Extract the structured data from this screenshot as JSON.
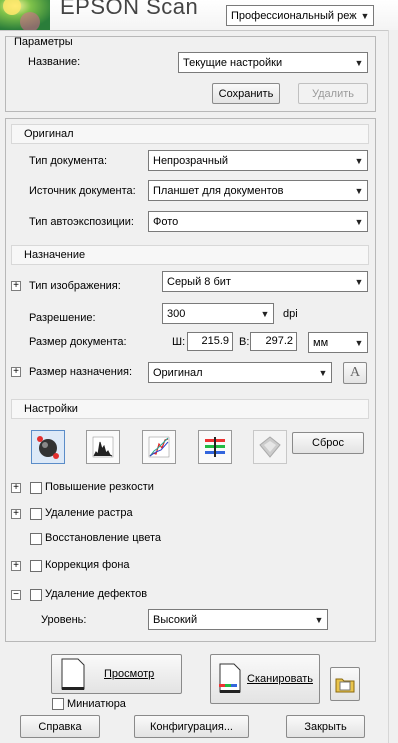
{
  "header": {
    "app_title": "EPSON Scan",
    "mode_select": "Профессиональный режим"
  },
  "params": {
    "group_label": "Параметры",
    "name_label": "Название:",
    "name_value": "Текущие настройки",
    "save_label": "Сохранить",
    "delete_label": "Удалить"
  },
  "original": {
    "title": "Оригинал",
    "doc_type_label": "Тип документа:",
    "doc_type_value": "Непрозрачный",
    "doc_source_label": "Источник документа:",
    "doc_source_value": "Планшет для документов",
    "autoexposure_label": "Тип автоэкспозиции:",
    "autoexposure_value": "Фото"
  },
  "destination": {
    "title": "Назначение",
    "image_type_label": "Тип изображения:",
    "image_type_value": "Серый 8 бит",
    "resolution_label": "Разрешение:",
    "resolution_value": "300",
    "dpi_label": "dpi",
    "doc_size_label": "Размер документа:",
    "width_label": "Ш:",
    "width_value": "215.9",
    "height_label": "В:",
    "height_value": "297.2",
    "unit_value": "мм",
    "target_size_label": "Размер назначения:",
    "target_size_value": "Оригинал"
  },
  "settings": {
    "title": "Настройки",
    "reset_label": "Сброс",
    "tools": [
      "histogram-icon",
      "tone-curve-icon",
      "color-balance-icon",
      "color-palette-icon"
    ],
    "options": [
      {
        "label": "Повышение резкости",
        "expander": "+"
      },
      {
        "label": "Удаление растра",
        "expander": "+"
      },
      {
        "label": "Восстановление цвета",
        "expander": ""
      },
      {
        "label": "Коррекция фона",
        "expander": "+"
      },
      {
        "label": "Удаление дефектов",
        "expander": "−"
      }
    ],
    "level_label": "Уровень:",
    "level_value": "Высокий"
  },
  "footer": {
    "preview_label": "Просмотр",
    "scan_label": "Сканировать",
    "thumbnail_label": "Миниатюра",
    "help_label": "Справка",
    "config_label": "Конфигурация...",
    "close_label": "Закрыть"
  }
}
